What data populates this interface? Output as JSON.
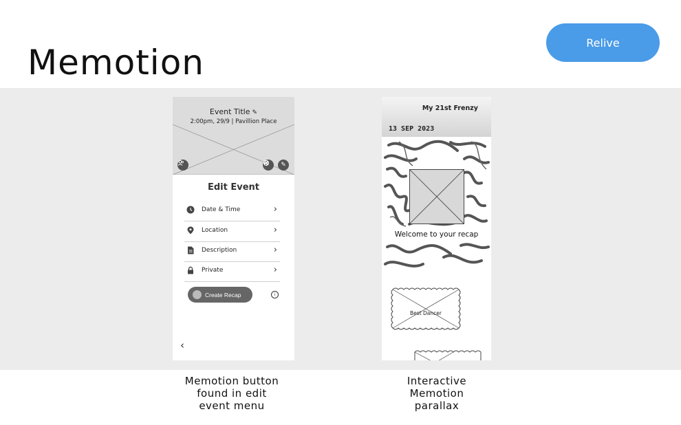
{
  "page": {
    "title": "Memotion",
    "relive_button": "Relive",
    "accent_color": "#4a9be8"
  },
  "edit_screen": {
    "event_title": "Event Title",
    "event_subtitle": "2:00pm, 29/9 | Pavillion Place",
    "heading": "Edit Event",
    "menu": [
      {
        "label": "Date & Time",
        "icon": "clock-icon"
      },
      {
        "label": "Location",
        "icon": "location-pin-icon"
      },
      {
        "label": "Description",
        "icon": "document-icon"
      },
      {
        "label": "Private",
        "icon": "lock-icon"
      }
    ],
    "create_recap": "Create Recap",
    "back_glyph": "‹",
    "chevron_glyph": "›",
    "info_glyph": "i"
  },
  "recap_screen": {
    "title": "My 21st Frenzy",
    "date": "13 SEP 2023",
    "welcome": "Welcome to your recap",
    "badge": "Best Dancer"
  },
  "captions": {
    "left": [
      "Memotion button",
      "found in edit",
      "event menu"
    ],
    "right": [
      "Interactive",
      "Memotion",
      "parallax"
    ]
  }
}
